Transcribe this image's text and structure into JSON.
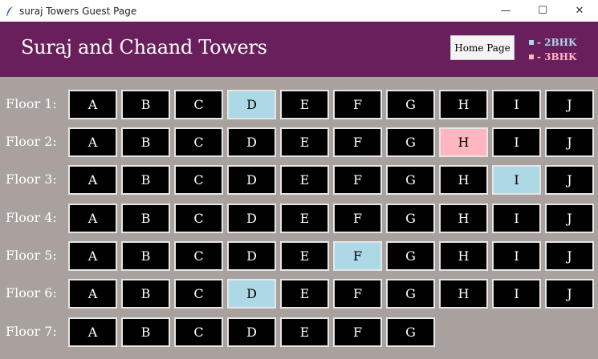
{
  "window": {
    "title": "suraj Towers Guest Page",
    "minimize": "—",
    "maximize": "☐",
    "close": "✕"
  },
  "header": {
    "title": "Suraj and Chaand Towers",
    "home_label": "Home Page",
    "legend": [
      {
        "label": "- 2BHK",
        "color": "#add8e6"
      },
      {
        "label": "- 3BHK",
        "color": "#ffb6c1"
      }
    ]
  },
  "colors": {
    "header_bg": "#6a1f5d",
    "body_bg": "#a9a19d",
    "flat_default": "#000000",
    "flat_2bhk": "#add8e6",
    "flat_3bhk": "#ffb6c1"
  },
  "floors": [
    {
      "label": "Floor 1:",
      "flats": [
        {
          "name": "A",
          "type": ""
        },
        {
          "name": "B",
          "type": ""
        },
        {
          "name": "C",
          "type": ""
        },
        {
          "name": "D",
          "type": "2BHK"
        },
        {
          "name": "E",
          "type": ""
        },
        {
          "name": "F",
          "type": ""
        },
        {
          "name": "G",
          "type": ""
        },
        {
          "name": "H",
          "type": ""
        },
        {
          "name": "I",
          "type": ""
        },
        {
          "name": "J",
          "type": ""
        }
      ]
    },
    {
      "label": "Floor 2:",
      "flats": [
        {
          "name": "A",
          "type": ""
        },
        {
          "name": "B",
          "type": ""
        },
        {
          "name": "C",
          "type": ""
        },
        {
          "name": "D",
          "type": ""
        },
        {
          "name": "E",
          "type": ""
        },
        {
          "name": "F",
          "type": ""
        },
        {
          "name": "G",
          "type": ""
        },
        {
          "name": "H",
          "type": "3BHK"
        },
        {
          "name": "I",
          "type": ""
        },
        {
          "name": "J",
          "type": ""
        }
      ]
    },
    {
      "label": "Floor 3:",
      "flats": [
        {
          "name": "A",
          "type": ""
        },
        {
          "name": "B",
          "type": ""
        },
        {
          "name": "C",
          "type": ""
        },
        {
          "name": "D",
          "type": ""
        },
        {
          "name": "E",
          "type": ""
        },
        {
          "name": "F",
          "type": ""
        },
        {
          "name": "G",
          "type": ""
        },
        {
          "name": "H",
          "type": ""
        },
        {
          "name": "I",
          "type": "2BHK"
        },
        {
          "name": "J",
          "type": ""
        }
      ]
    },
    {
      "label": "Floor 4:",
      "flats": [
        {
          "name": "A",
          "type": ""
        },
        {
          "name": "B",
          "type": ""
        },
        {
          "name": "C",
          "type": ""
        },
        {
          "name": "D",
          "type": ""
        },
        {
          "name": "E",
          "type": ""
        },
        {
          "name": "F",
          "type": ""
        },
        {
          "name": "G",
          "type": ""
        },
        {
          "name": "H",
          "type": ""
        },
        {
          "name": "I",
          "type": ""
        },
        {
          "name": "J",
          "type": ""
        }
      ]
    },
    {
      "label": "Floor 5:",
      "flats": [
        {
          "name": "A",
          "type": ""
        },
        {
          "name": "B",
          "type": ""
        },
        {
          "name": "C",
          "type": ""
        },
        {
          "name": "D",
          "type": ""
        },
        {
          "name": "E",
          "type": ""
        },
        {
          "name": "F",
          "type": "2BHK"
        },
        {
          "name": "G",
          "type": ""
        },
        {
          "name": "H",
          "type": ""
        },
        {
          "name": "I",
          "type": ""
        },
        {
          "name": "J",
          "type": ""
        }
      ]
    },
    {
      "label": "Floor 6:",
      "flats": [
        {
          "name": "A",
          "type": ""
        },
        {
          "name": "B",
          "type": ""
        },
        {
          "name": "C",
          "type": ""
        },
        {
          "name": "D",
          "type": "2BHK"
        },
        {
          "name": "E",
          "type": ""
        },
        {
          "name": "F",
          "type": ""
        },
        {
          "name": "G",
          "type": ""
        },
        {
          "name": "H",
          "type": ""
        },
        {
          "name": "I",
          "type": ""
        },
        {
          "name": "J",
          "type": ""
        }
      ]
    },
    {
      "label": "Floor 7:",
      "flats": [
        {
          "name": "A",
          "type": ""
        },
        {
          "name": "B",
          "type": ""
        },
        {
          "name": "C",
          "type": ""
        },
        {
          "name": "D",
          "type": ""
        },
        {
          "name": "E",
          "type": ""
        },
        {
          "name": "F",
          "type": ""
        },
        {
          "name": "G",
          "type": ""
        }
      ]
    }
  ]
}
